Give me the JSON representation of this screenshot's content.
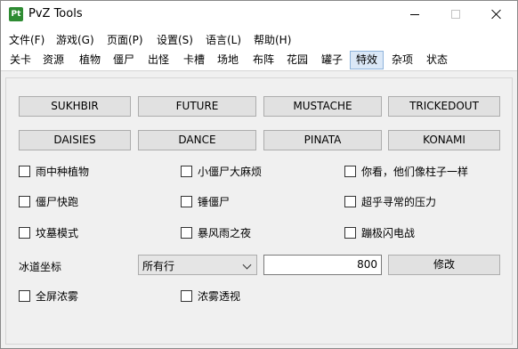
{
  "window": {
    "title": "PvZ Tools",
    "icon_text": "Pt"
  },
  "menu": [
    "文件(F)",
    "游戏(G)",
    "页面(P)",
    "设置(S)",
    "语言(L)",
    "帮助(H)"
  ],
  "tabs": [
    "关卡",
    "资源",
    "植物",
    "僵尸",
    "出怪",
    "卡槽",
    "场地",
    "布阵",
    "花园",
    "罐子",
    "特效",
    "杂项",
    "状态"
  ],
  "active_tab": "特效",
  "codes_row1": [
    "SUKHBIR",
    "FUTURE",
    "MUSTACHE",
    "TRICKEDOUT"
  ],
  "codes_row2": [
    "DAISIES",
    "DANCE",
    "PINATA",
    "KONAMI"
  ],
  "checkboxes": {
    "rain_plants": "雨中种植物",
    "tiny_zombies": "小僵尸大麻烦",
    "column_like": "你看，他们像柱子一样",
    "zombie_quick": "僵尸快跑",
    "whack": "锤僵尸",
    "unusual_pressure": "超乎寻常的压力",
    "graveyard_mode": "坟墓模式",
    "stormy_night": "暴风雨之夜",
    "bungee_blitz": "蹦极闪电战",
    "full_fog": "全屏浓雾",
    "fog_see": "浓雾透视"
  },
  "ice_trail": {
    "label": "冰道坐标",
    "row_select": "所有行",
    "value": "800",
    "button": "修改"
  },
  "colors": {
    "active_tab_bg": "#dbe8f7",
    "button_bg": "#e1e1e1",
    "window_bg": "#f0f0f0"
  }
}
